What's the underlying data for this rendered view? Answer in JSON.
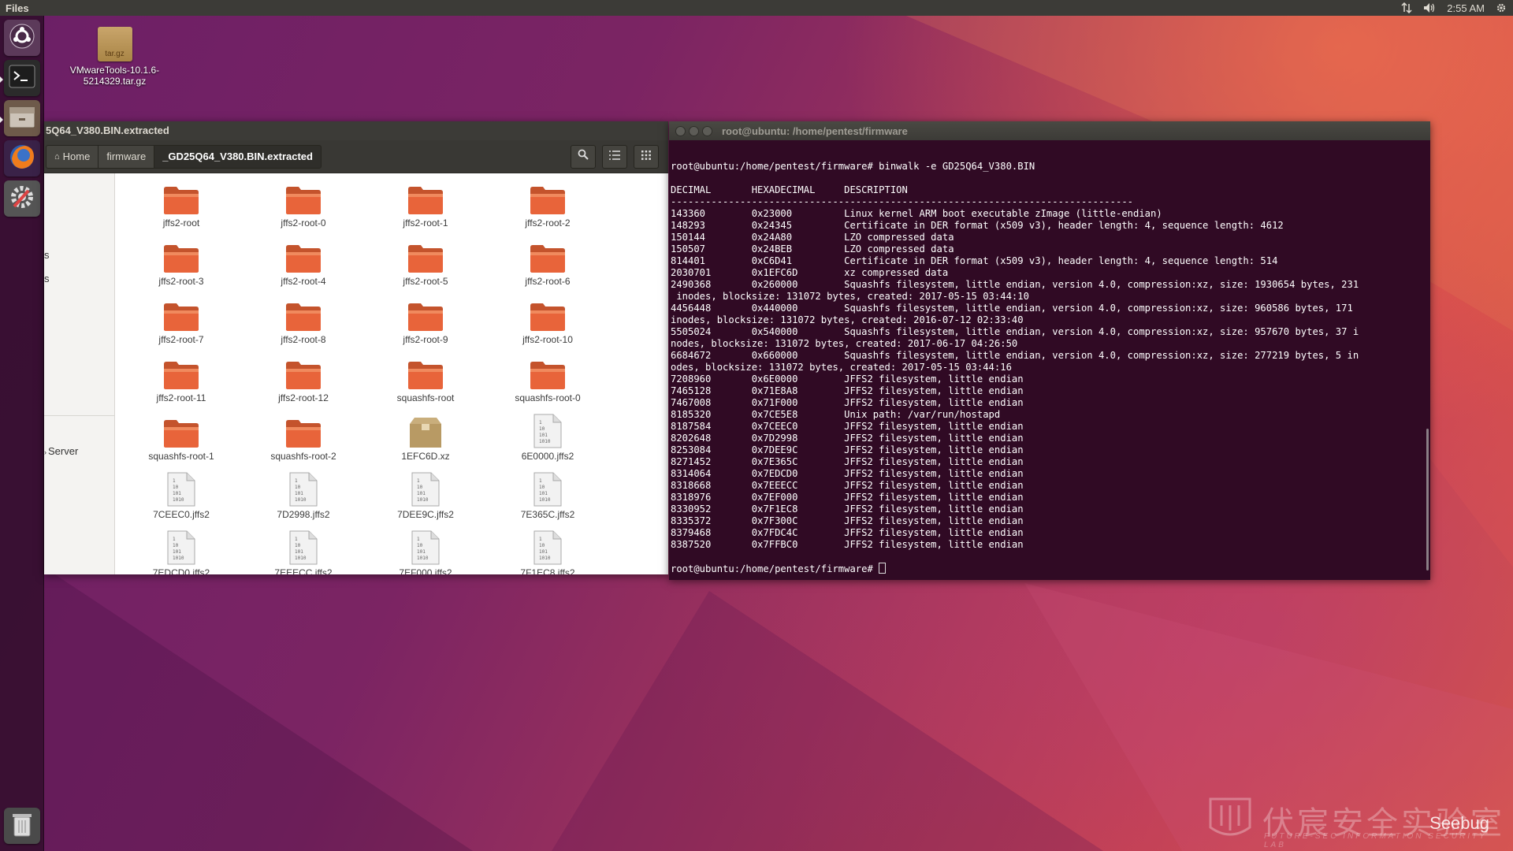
{
  "top_panel": {
    "app_title": "Files",
    "time": "2:55 AM"
  },
  "launcher": {
    "items": [
      {
        "name": "dash-icon"
      },
      {
        "name": "terminal-icon"
      },
      {
        "name": "files-icon"
      },
      {
        "name": "firefox-icon"
      },
      {
        "name": "system-settings-icon"
      },
      {
        "name": "trash-icon"
      }
    ]
  },
  "desktop": {
    "file": {
      "icon_text": "tar.gz",
      "label_line1": "VMwareTools-10.1.6-",
      "label_line2": "5214329.tar.gz"
    }
  },
  "file_manager": {
    "title": "5Q64_V380.BIN.extracted",
    "breadcrumbs": [
      "Home",
      "firmware",
      "_GD25Q64_V380.BIN.extracted"
    ],
    "sidebar": {
      "item_s1": "s",
      "item_s2": "s",
      "item_server": "Server"
    },
    "items": [
      {
        "label": "jffs2-root",
        "type": "folder"
      },
      {
        "label": "jffs2-root-0",
        "type": "folder"
      },
      {
        "label": "jffs2-root-1",
        "type": "folder"
      },
      {
        "label": "jffs2-root-2",
        "type": "folder"
      },
      {
        "label": "jffs2-root-3",
        "type": "folder"
      },
      {
        "label": "jffs2-root-4",
        "type": "folder"
      },
      {
        "label": "jffs2-root-5",
        "type": "folder"
      },
      {
        "label": "jffs2-root-6",
        "type": "folder"
      },
      {
        "label": "jffs2-root-7",
        "type": "folder"
      },
      {
        "label": "jffs2-root-8",
        "type": "folder"
      },
      {
        "label": "jffs2-root-9",
        "type": "folder"
      },
      {
        "label": "jffs2-root-10",
        "type": "folder"
      },
      {
        "label": "jffs2-root-11",
        "type": "folder"
      },
      {
        "label": "jffs2-root-12",
        "type": "folder"
      },
      {
        "label": "squashfs-root",
        "type": "folder"
      },
      {
        "label": "squashfs-root-0",
        "type": "folder"
      },
      {
        "label": "squashfs-root-1",
        "type": "folder"
      },
      {
        "label": "squashfs-root-2",
        "type": "folder"
      },
      {
        "label": "1EFC6D.xz",
        "type": "archive"
      },
      {
        "label": "6E0000.jffs2",
        "type": "binary"
      },
      {
        "label": "7CEEC0.jffs2",
        "type": "binary"
      },
      {
        "label": "7D2998.jffs2",
        "type": "binary"
      },
      {
        "label": "7DEE9C.jffs2",
        "type": "binary"
      },
      {
        "label": "7E365C.jffs2",
        "type": "binary"
      },
      {
        "label": "7EDCD0.jffs2",
        "type": "binary"
      },
      {
        "label": "7EEECC.jffs2",
        "type": "binary"
      },
      {
        "label": "7EF000.jffs2",
        "type": "binary"
      },
      {
        "label": "7F1EC8.jffs2",
        "type": "binary"
      }
    ]
  },
  "terminal": {
    "title": "root@ubuntu: /home/pentest/firmware",
    "lines": [
      "root@ubuntu:/home/pentest/firmware# binwalk -e GD25Q64_V380.BIN",
      "",
      "DECIMAL       HEXADECIMAL     DESCRIPTION",
      "--------------------------------------------------------------------------------",
      "143360        0x23000         Linux kernel ARM boot executable zImage (little-endian)",
      "148293        0x24345         Certificate in DER format (x509 v3), header length: 4, sequence length: 4612",
      "150144        0x24A80         LZO compressed data",
      "150507        0x24BEB         LZO compressed data",
      "814401        0xC6D41         Certificate in DER format (x509 v3), header length: 4, sequence length: 514",
      "2030701       0x1EFC6D        xz compressed data",
      "2490368       0x260000        Squashfs filesystem, little endian, version 4.0, compression:xz, size: 1930654 bytes, 231",
      " inodes, blocksize: 131072 bytes, created: 2017-05-15 03:44:10",
      "4456448       0x440000        Squashfs filesystem, little endian, version 4.0, compression:xz, size: 960586 bytes, 171",
      "inodes, blocksize: 131072 bytes, created: 2016-07-12 02:33:40",
      "5505024       0x540000        Squashfs filesystem, little endian, version 4.0, compression:xz, size: 957670 bytes, 37 i",
      "nodes, blocksize: 131072 bytes, created: 2017-06-17 04:26:50",
      "6684672       0x660000        Squashfs filesystem, little endian, version 4.0, compression:xz, size: 277219 bytes, 5 in",
      "odes, blocksize: 131072 bytes, created: 2017-05-15 03:44:16",
      "7208960       0x6E0000        JFFS2 filesystem, little endian",
      "7465128       0x71E8A8        JFFS2 filesystem, little endian",
      "7467008       0x71F000        JFFS2 filesystem, little endian",
      "8185320       0x7CE5E8        Unix path: /var/run/hostapd",
      "8187584       0x7CEEC0        JFFS2 filesystem, little endian",
      "8202648       0x7D2998        JFFS2 filesystem, little endian",
      "8253084       0x7DEE9C        JFFS2 filesystem, little endian",
      "8271452       0x7E365C        JFFS2 filesystem, little endian",
      "8314064       0x7EDCD0        JFFS2 filesystem, little endian",
      "8318668       0x7EEECC        JFFS2 filesystem, little endian",
      "8318976       0x7EF000        JFFS2 filesystem, little endian",
      "8330952       0x7F1EC8        JFFS2 filesystem, little endian",
      "8335372       0x7F300C        JFFS2 filesystem, little endian",
      "8379468       0x7FDC4C        JFFS2 filesystem, little endian",
      "8387520       0x7FFBC0        JFFS2 filesystem, little endian",
      ""
    ],
    "prompt": "root@ubuntu:/home/pentest/firmware# "
  },
  "watermark": {
    "chinese": "伏宸安全实验室",
    "subtitle": "FUTURE-SEC INFORMATION SECURITY LAB",
    "brand": "Seebug"
  },
  "colors": {
    "folder": "#e8643a",
    "terminal_bg": "#300a24",
    "panel": "#3c3b37"
  }
}
